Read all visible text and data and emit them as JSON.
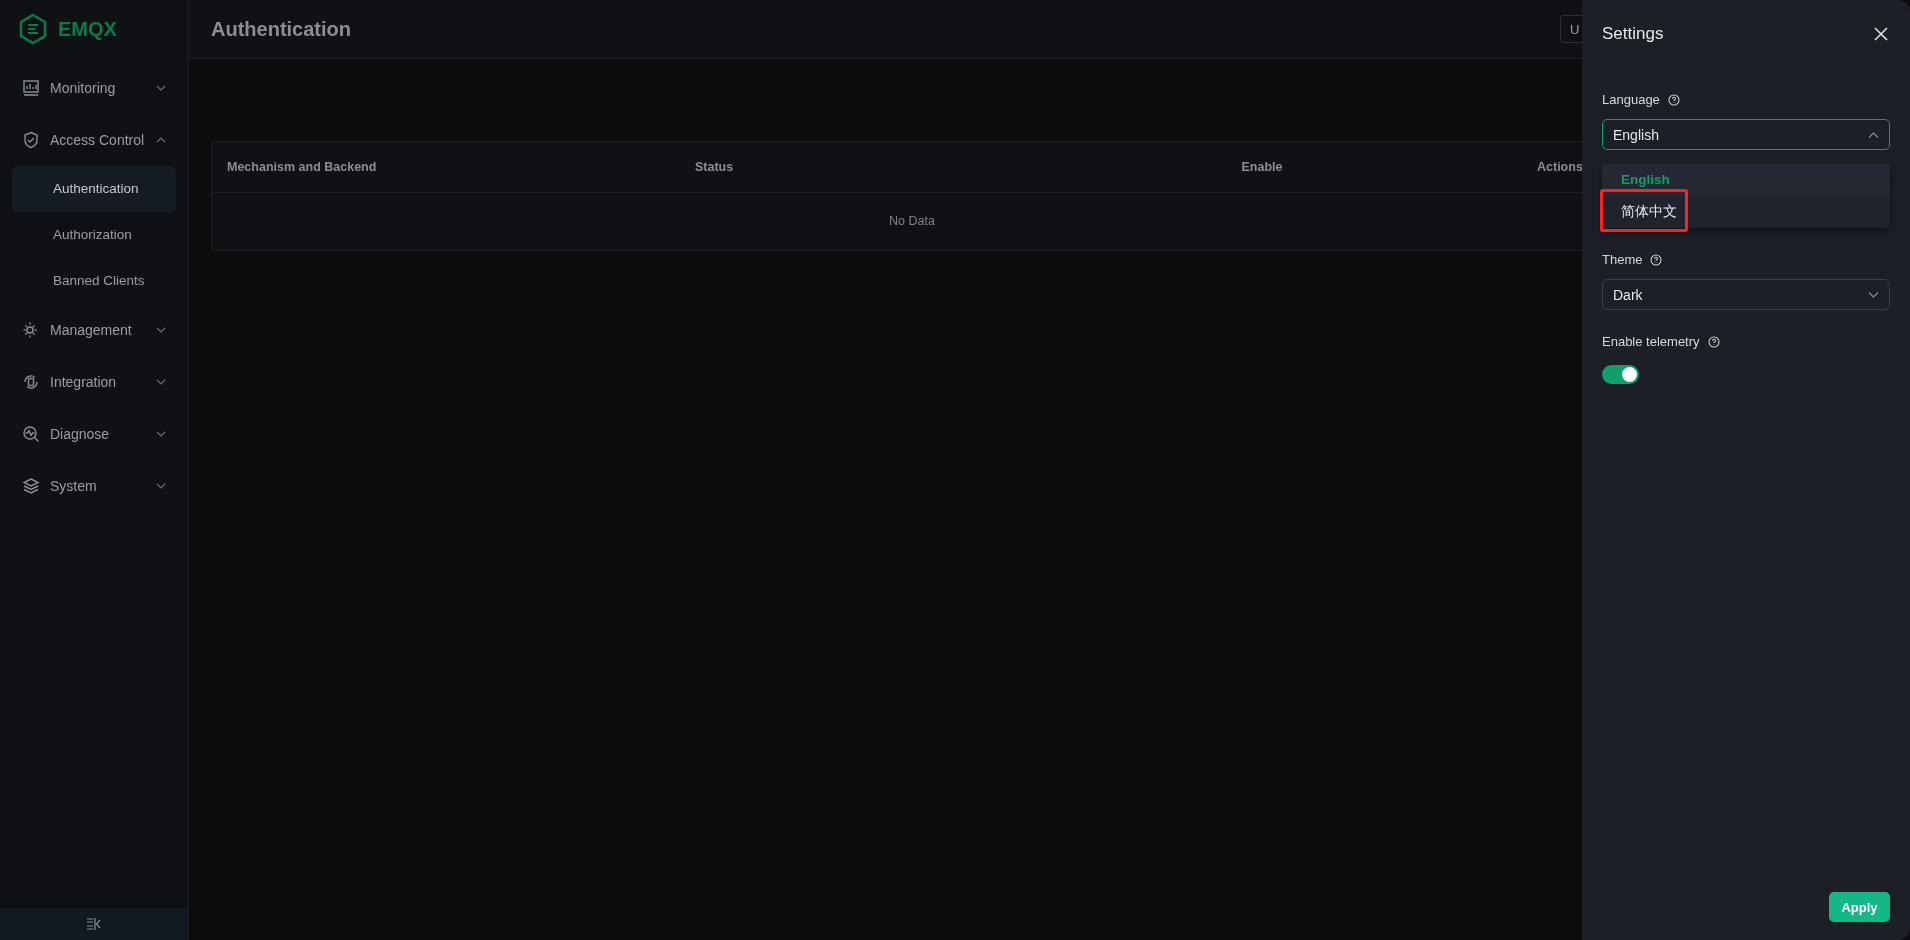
{
  "logo": {
    "text": "EMQX"
  },
  "sidebar": {
    "items": [
      {
        "label": "Monitoring",
        "expanded": false
      },
      {
        "label": "Access Control",
        "expanded": true,
        "children": [
          {
            "label": "Authentication",
            "selected": true
          },
          {
            "label": "Authorization",
            "selected": false
          },
          {
            "label": "Banned Clients",
            "selected": false
          }
        ]
      },
      {
        "label": "Management",
        "expanded": false
      },
      {
        "label": "Integration",
        "expanded": false
      },
      {
        "label": "Diagnose",
        "expanded": false
      },
      {
        "label": "System",
        "expanded": false
      }
    ]
  },
  "header": {
    "title": "Authentication",
    "button": "U"
  },
  "table": {
    "columns": [
      "Mechanism and Backend",
      "Status",
      "Enable",
      "Actions"
    ],
    "empty_text": "No Data"
  },
  "settings": {
    "title": "Settings",
    "language": {
      "label": "Language",
      "value": "English",
      "expanded": true,
      "options": [
        {
          "label": "English",
          "selected": true
        },
        {
          "label": "简体中文",
          "selected": false
        }
      ]
    },
    "theme": {
      "label": "Theme",
      "value": "Dark"
    },
    "telemetry": {
      "label": "Enable telemetry",
      "on": true
    },
    "apply": "Apply"
  }
}
